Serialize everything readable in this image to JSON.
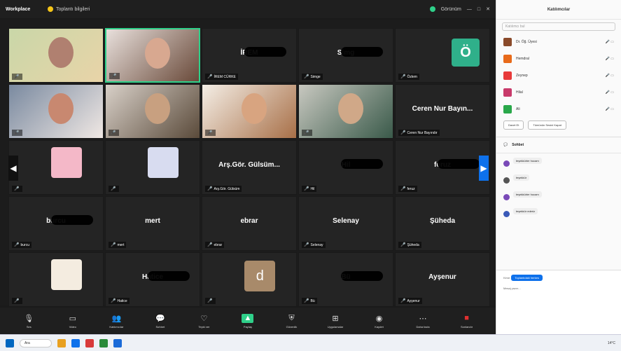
{
  "title_bar": {
    "brand": "Workplace",
    "meeting_label": "Toplantı bilgileri",
    "view_label": "Görünüm"
  },
  "tiles": [
    {
      "label": "",
      "video": true
    },
    {
      "label": "",
      "video": true
    },
    {
      "big": "İREM",
      "label": "İREM CÜRKE"
    },
    {
      "big": "Simg",
      "label": "Simge"
    },
    {
      "big": "Ö",
      "label": "Özlem"
    },
    {
      "label": "",
      "video": true
    },
    {
      "label": "",
      "video": true
    },
    {
      "label": "",
      "video": true
    },
    {
      "label": "",
      "video": true
    },
    {
      "big": "Ceren Nur Bayın...",
      "label": "Ceren Nur Bayındır"
    },
    {
      "label": "",
      "avatar": true
    },
    {
      "label": "",
      "avatar": true
    },
    {
      "big": "Arş.Gör. Gülsüm...",
      "label": "Arş.Gör. Gülsüm"
    },
    {
      "big": "Hil",
      "label": "Hil"
    },
    {
      "big": "feruz",
      "label": "feruz"
    },
    {
      "big": "burcu",
      "label": "burcu"
    },
    {
      "big": "mert",
      "label": "mert"
    },
    {
      "big": "ebrar",
      "label": "ebrar"
    },
    {
      "big": "Selenay",
      "label": "Selenay"
    },
    {
      "big": "Şüheda",
      "label": "Şüheda"
    },
    {
      "label": "",
      "avatar": true
    },
    {
      "big": "Hatice",
      "label": "Hatice"
    },
    {
      "big": "d",
      "label": ""
    },
    {
      "big": "Bü",
      "label": "Bü"
    },
    {
      "big": "Ayşenur",
      "label": "Ayşenur"
    }
  ],
  "toolbar": [
    {
      "icon": "mic-icon",
      "glyph": "🎙",
      "label": "Ses"
    },
    {
      "icon": "video-icon",
      "glyph": "▭",
      "label": "Video"
    },
    {
      "icon": "participants-icon",
      "glyph": "👥",
      "label": "Katılımcılar"
    },
    {
      "icon": "chat-icon",
      "glyph": "💬",
      "label": "Sohbet"
    },
    {
      "icon": "react-icon",
      "glyph": "♡",
      "label": "Tepki ver"
    },
    {
      "icon": "share-icon",
      "glyph": "▲",
      "label": "Paylaş"
    },
    {
      "icon": "shield-icon",
      "glyph": "⛨",
      "label": "Güvenlik"
    },
    {
      "icon": "apps-icon",
      "glyph": "⊞",
      "label": "Uygulamalar"
    },
    {
      "icon": "record-icon",
      "glyph": "◉",
      "label": "Kaydet"
    },
    {
      "icon": "more-icon",
      "glyph": "⋯",
      "label": "Daha fazla"
    },
    {
      "icon": "end-icon",
      "glyph": "■",
      "label": "Sonlandır"
    }
  ],
  "panel": {
    "title": "Katılımcılar",
    "search_placeholder": "Katılımcı bul",
    "participants": [
      {
        "name": "Dr. Öğ. Üyesi",
        "color": "#8a4a2a"
      },
      {
        "name": "Hemdral",
        "color": "#e86a1a"
      },
      {
        "name": "Zeynep",
        "color": "#e83a3a"
      },
      {
        "name": "Hilal",
        "color": "#c83a6a"
      },
      {
        "name": "Ali",
        "color": "#2aa84a"
      }
    ],
    "invite_button": "Davet Et",
    "mute_all_button": "Tümünün Sesini Kapat"
  },
  "chat": {
    "title": "Sohbet",
    "messages": [
      {
        "who": "",
        "text": "teşekkürler hocam",
        "color": "#7a4ab8"
      },
      {
        "who": "",
        "text": "teşekkür",
        "color": "#555555"
      },
      {
        "who": "",
        "text": "teşekkürler hocam",
        "color": "#7a4ab8"
      },
      {
        "who": "",
        "text": "teşekkür ederiz",
        "color": "#3a5ab8"
      }
    ],
    "to_label": "Kime:",
    "to_button": "Toplantıdaki herkes",
    "input_placeholder": "Mesaj yazın..."
  },
  "taskbar": {
    "search": "Ara",
    "weather": "14°C"
  }
}
